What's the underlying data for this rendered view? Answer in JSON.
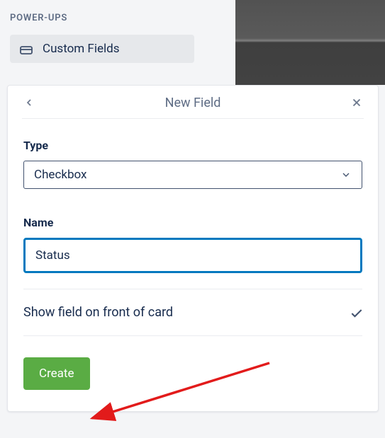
{
  "sidebar": {
    "section_label": "POWER-UPS",
    "custom_fields_label": "Custom Fields"
  },
  "modal": {
    "title": "New Field",
    "type_label": "Type",
    "type_value": "Checkbox",
    "name_label": "Name",
    "name_value": "Status",
    "show_on_front_label": "Show field on front of card",
    "create_label": "Create"
  }
}
